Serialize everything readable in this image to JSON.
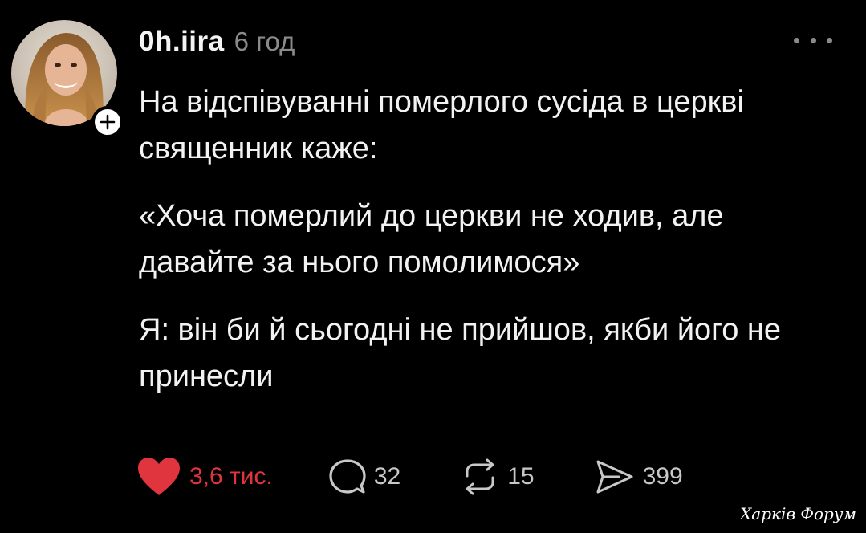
{
  "post": {
    "username": "0h.iira",
    "time_ago": "6 год",
    "paragraphs": [
      "На відспівуванні померлого сусіда в церкві священник каже:",
      "«Хоча померлий до церкви не ходив, але давайте за нього помолимося»",
      "Я: він би й сьогодні не прийшов, якби його не принесли"
    ]
  },
  "actions": {
    "likes": "3,6 тис.",
    "replies": "32",
    "reposts": "15",
    "shares": "399"
  },
  "icons": {
    "like": "heart-icon",
    "reply": "comment-bubble-icon",
    "repost": "repost-arrows-icon",
    "share": "send-icon",
    "follow": "plus-icon",
    "more": "ellipsis-icon"
  },
  "colors": {
    "background": "#000000",
    "like_active": "#e0343e",
    "muted": "#8a8a8a"
  },
  "watermark": {
    "text": "Харків Форум"
  }
}
